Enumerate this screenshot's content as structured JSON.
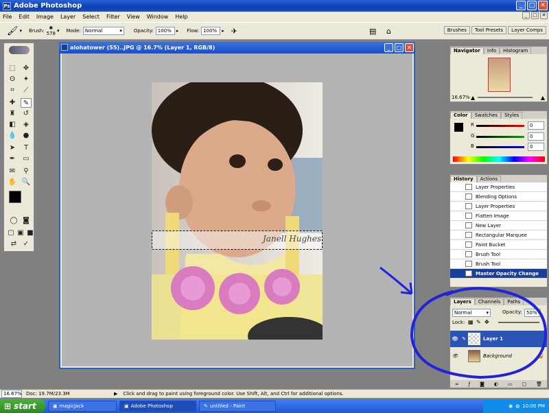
{
  "app": {
    "title": "Adobe Photoshop"
  },
  "menu": [
    "File",
    "Edit",
    "Image",
    "Layer",
    "Select",
    "Filter",
    "View",
    "Window",
    "Help"
  ],
  "options": {
    "brush_label": "Brush:",
    "brush_size": "578",
    "mode_label": "Mode:",
    "mode_value": "Normal",
    "opacity_label": "Opacity:",
    "opacity_value": "100%",
    "flow_label": "Flow:",
    "flow_value": "100%",
    "palette_tabs": [
      "Brushes",
      "Tool Presets",
      "Layer Comps"
    ]
  },
  "document": {
    "title": "alohatower (55)..JPG @ 16.7% (Layer 1, RGB/8)",
    "watermark": "Janell Hughes"
  },
  "navigator": {
    "tabs": [
      "Navigator",
      "Info",
      "Histogram"
    ],
    "zoom": "16.67%"
  },
  "color": {
    "tabs": [
      "Color",
      "Swatches",
      "Styles"
    ],
    "channels": [
      {
        "label": "R",
        "value": "0"
      },
      {
        "label": "G",
        "value": "0"
      },
      {
        "label": "B",
        "value": "0"
      }
    ]
  },
  "history": {
    "tabs": [
      "History",
      "Actions"
    ],
    "items": [
      "Layer Properties",
      "Blending Options",
      "Layer Properties",
      "Flatten Image",
      "New Layer",
      "Rectangular Marquee",
      "Paint Bucket",
      "Brush Tool",
      "Brush Tool",
      "Master Opacity Change"
    ]
  },
  "layers": {
    "tabs": [
      "Layers",
      "Channels",
      "Paths"
    ],
    "blend_mode": "Normal",
    "opacity_label": "Opacity:",
    "opacity_value": "50%",
    "lock_label": "Lock:",
    "items": [
      "Layer 1",
      "Background"
    ]
  },
  "status": {
    "zoom": "16.67%",
    "doc": "Doc: 19.7M/23.3M",
    "hint": "Click and drag to paint using foreground color.  Use Shift, Alt, and Ctrl for additional options."
  },
  "taskbar": {
    "start": "start",
    "tasks": [
      "magicJack",
      "Adobe Photoshop",
      "untitled - Paint"
    ],
    "clock": "10:00 PM"
  },
  "colors": {
    "annotation": "#2222dd",
    "selection": "#1a3e9c"
  }
}
